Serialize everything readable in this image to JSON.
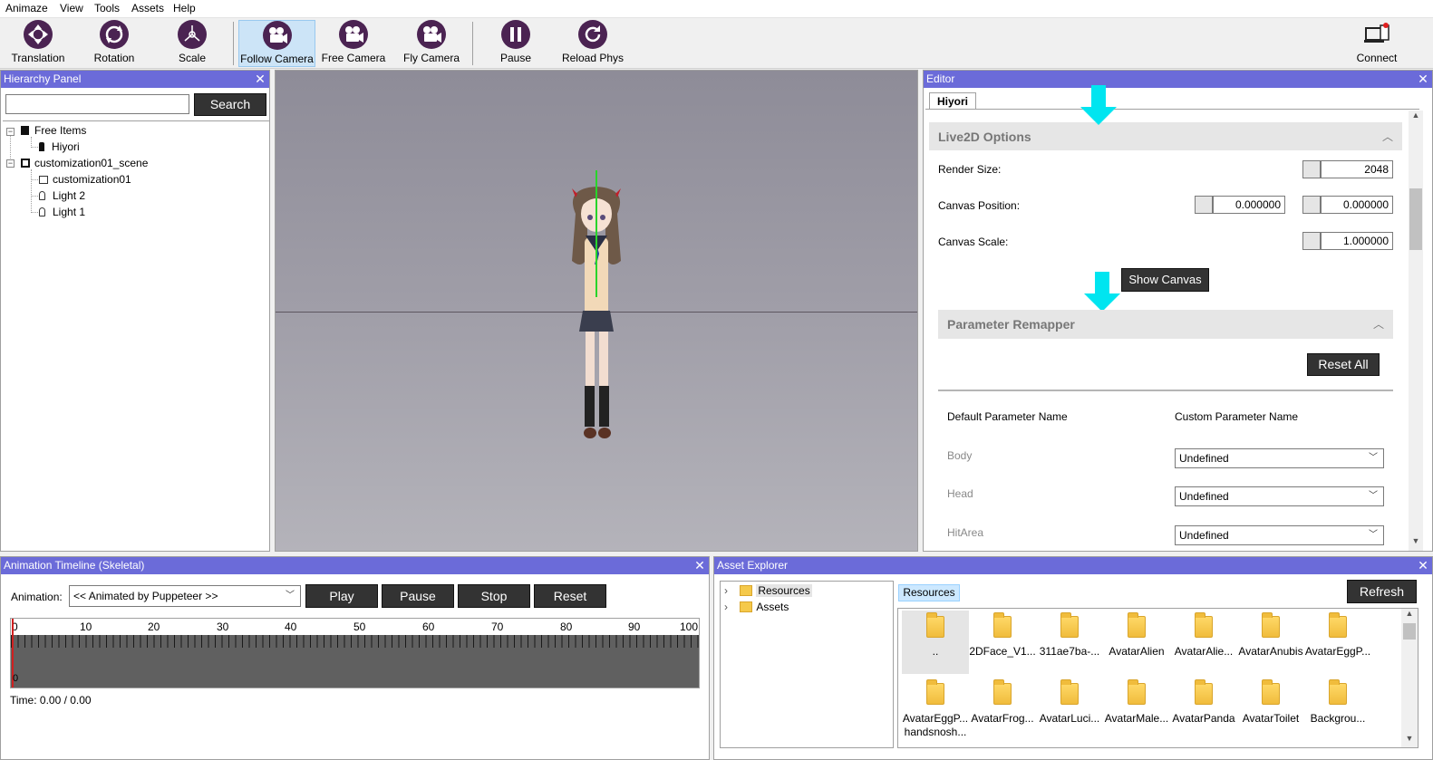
{
  "menu": [
    "Animaze",
    "View",
    "Tools",
    "Assets",
    "Help"
  ],
  "toolbar": {
    "translation": "Translation",
    "rotation": "Rotation",
    "scale": "Scale",
    "follow_camera": "Follow Camera",
    "free_camera": "Free Camera",
    "fly_camera": "Fly Camera",
    "pause": "Pause",
    "reload_phys": "Reload Phys",
    "connect": "Connect"
  },
  "hierarchy": {
    "title": "Hierarchy Panel",
    "close": "✕",
    "search_value": "",
    "search_button": "Search",
    "nodes": [
      "Free Items",
      "Hiyori",
      "customization01_scene",
      "customization01",
      "Light 2",
      "Light 1"
    ]
  },
  "editor": {
    "title": "Editor",
    "close": "✕",
    "tab": "Hiyori",
    "live2d_header": "Live2D Options",
    "render_size_label": "Render Size:",
    "render_size": "2048",
    "canvas_pos_label": "Canvas Position:",
    "canvas_pos_x": "0.000000",
    "canvas_pos_y": "0.000000",
    "canvas_scale_label": "Canvas Scale:",
    "canvas_scale": "1.000000",
    "show_canvas": "Show Canvas",
    "remapper_header": "Parameter Remapper",
    "reset_all": "Reset All",
    "col_default": "Default Parameter Name",
    "col_custom": "Custom Parameter Name",
    "params": [
      {
        "name": "Body",
        "value": "Undefined"
      },
      {
        "name": "Head",
        "value": "Undefined"
      },
      {
        "name": "HitArea",
        "value": "Undefined"
      }
    ],
    "accent_color": "#00e5f0"
  },
  "timeline": {
    "title": "Animation Timeline (Skeletal)",
    "close": "✕",
    "animation_label": "Animation:",
    "animation_value": "<< Animated by Puppeteer >>",
    "play": "Play",
    "pause": "Pause",
    "stop": "Stop",
    "reset": "Reset",
    "ticks": [
      "0",
      "10",
      "20",
      "30",
      "40",
      "50",
      "60",
      "70",
      "80",
      "90",
      "100"
    ],
    "cursor_label": "0",
    "time": "Time: 0.00 / 0.00"
  },
  "assets": {
    "title": "Asset Explorer",
    "close": "✕",
    "tree": [
      "Resources",
      "Assets"
    ],
    "breadcrumb": "Resources",
    "refresh": "Refresh",
    "files": [
      "..",
      "2DFace_V1...",
      "311ae7ba-...",
      "AvatarAlien",
      "AvatarAlie...",
      "AvatarAnubis",
      "AvatarEggP...",
      "AvatarEggP... handsnosh...",
      "AvatarFrog...",
      "AvatarLuci...",
      "AvatarMale...",
      "AvatarPanda",
      "AvatarToilet",
      "Backgrou..."
    ]
  }
}
